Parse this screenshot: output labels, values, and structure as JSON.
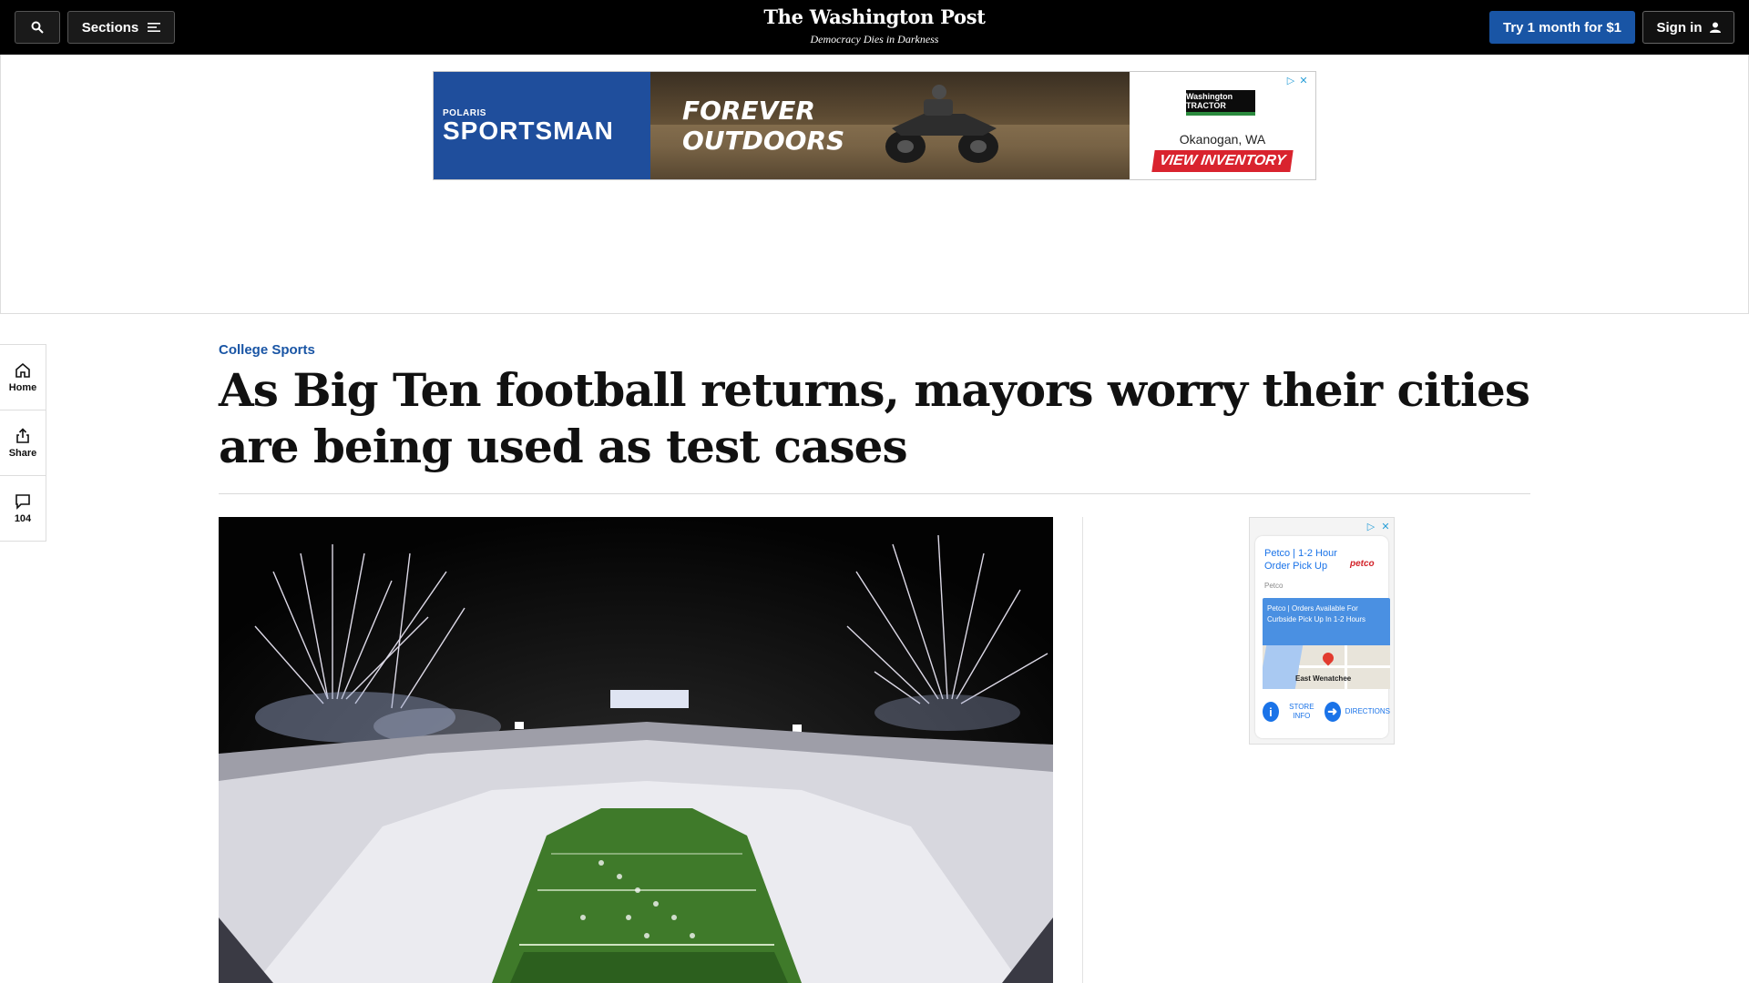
{
  "header": {
    "sections_label": "Sections",
    "logo": "The Washington Post",
    "tagline": "Democracy Dies in Darkness",
    "subscribe_label": "Try 1 month for $1",
    "signin_label": "Sign in"
  },
  "top_ad": {
    "brand_small": "POLARIS",
    "brand_big": "SPORTSMAN",
    "headline_line1": "FOREVER",
    "headline_line2": "OUTDOORS",
    "dealer_logo": "Washington TRACTOR",
    "dealer_location": "Okanogan, WA",
    "cta": "VIEW INVENTORY"
  },
  "left_rail": {
    "home_label": "Home",
    "share_label": "Share",
    "comments_count": "104"
  },
  "article": {
    "kicker": "College Sports",
    "headline": "As Big Ten football returns, mayors worry their cities are being used as test cases"
  },
  "side_ad": {
    "title": "Petco | 1-2 Hour Order Pick Up",
    "brand": "petco",
    "sub": "Petco",
    "blurb": "Petco | Orders Available For Curbside Pick Up In 1-2 Hours",
    "map_label": "East Wenatchee",
    "store_info": "STORE INFO",
    "directions": "DIRECTIONS"
  },
  "colors": {
    "header_bg": "#000000",
    "subscribe_button": "#1955a5",
    "kicker": "#1955a5"
  }
}
